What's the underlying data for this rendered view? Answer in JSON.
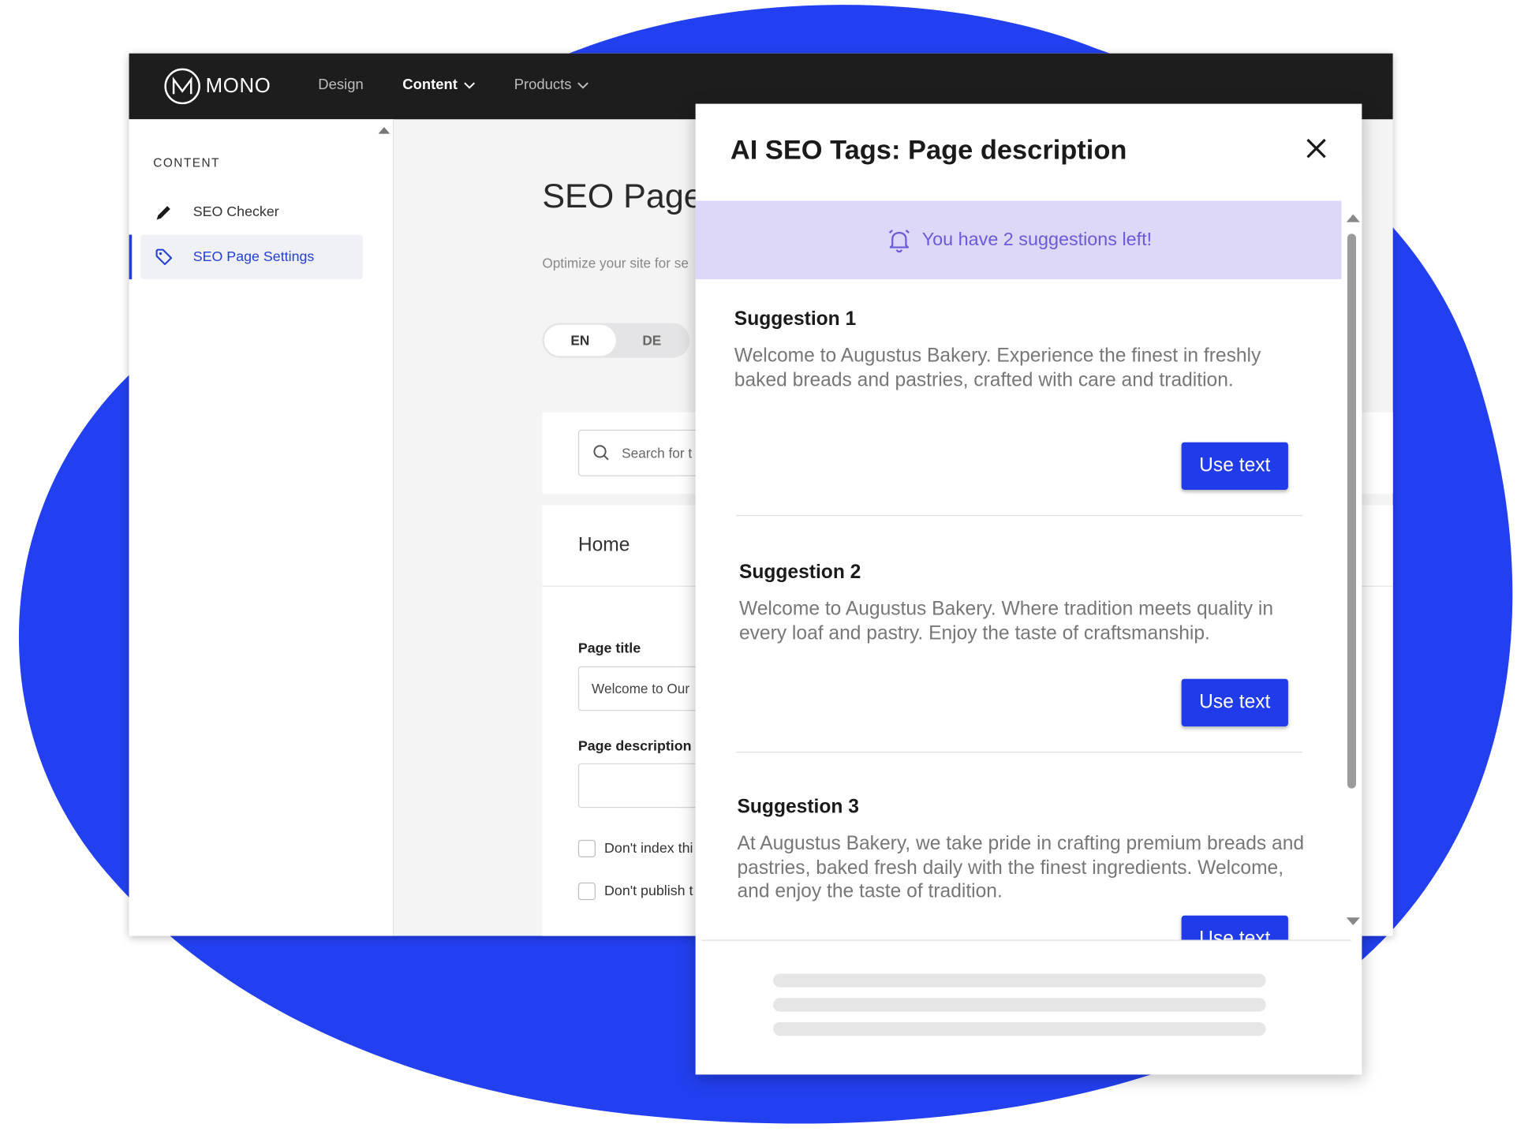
{
  "brand": {
    "name": "MONO",
    "color_accent": "#1f3bea",
    "color_blob": "#2340f0"
  },
  "topnav": {
    "items": [
      {
        "label": "Design",
        "active": false,
        "dropdown": false
      },
      {
        "label": "Content",
        "active": true,
        "dropdown": true
      },
      {
        "label": "Products",
        "active": false,
        "dropdown": true
      }
    ]
  },
  "sidebar": {
    "heading": "CONTENT",
    "items": [
      {
        "label": "SEO Checker",
        "icon": "pencil-icon",
        "active": false
      },
      {
        "label": "SEO Page Settings",
        "icon": "tag-icon",
        "active": true
      }
    ]
  },
  "main": {
    "title": "SEO Page",
    "subtitle": "Optimize your site for se",
    "languages": [
      "EN",
      "DE"
    ],
    "selected_language": "EN",
    "search": {
      "placeholder": "Search for t",
      "icon": "search-icon"
    },
    "page_card": {
      "page_name": "Home",
      "page_title_label": "Page title",
      "page_title_value": "Welcome to Our",
      "page_description_label": "Page description",
      "page_description_value": "",
      "checkbox_noindex": "Don't index thi",
      "checkbox_nopublish": "Don't publish t"
    }
  },
  "modal": {
    "title": "AI SEO Tags: Page description",
    "banner": {
      "text": "You have 2 suggestions left!",
      "icon": "bell-icon"
    },
    "suggestions": [
      {
        "title": "Suggestion 1",
        "text": "Welcome to Augustus Bakery. Experience the finest in freshly baked breads and pastries, crafted with care and tradition.",
        "button": "Use text"
      },
      {
        "title": "Suggestion 2",
        "text": "Welcome to Augustus Bakery. Where tradition meets quality in every loaf and pastry. Enjoy the taste of craftsmanship.",
        "button": "Use text"
      },
      {
        "title": "Suggestion 3",
        "text": "At Augustus Bakery, we take pride in crafting premium breads and pastries, baked fresh daily with the finest ingredients. Welcome, and enjoy the taste of tradition.",
        "button": "Use text"
      }
    ]
  }
}
